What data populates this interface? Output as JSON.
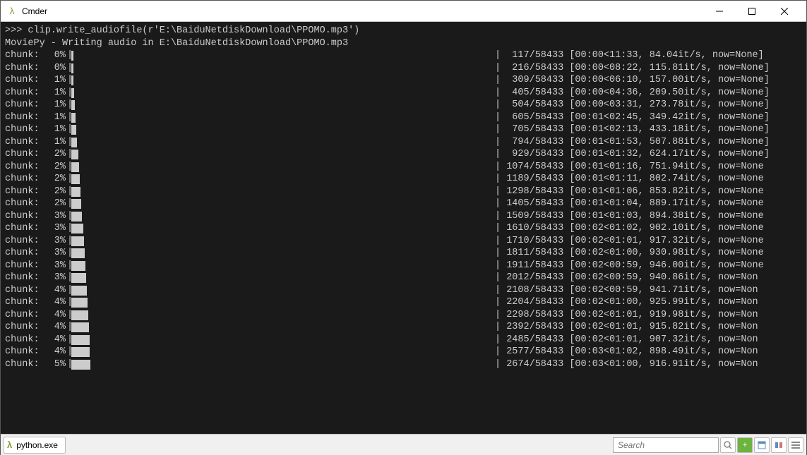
{
  "window": {
    "title": "Cmder"
  },
  "terminal": {
    "prompt": ">>> ",
    "command": "clip.write_audiofile(r'E:\\BaiduNetdiskDownload\\PPOMO.mp3')",
    "status_line": "MoviePy - Writing audio in E:\\BaiduNetdiskDownload\\PPOMO.mp3",
    "label": "chunk:",
    "total": 58433,
    "rows": [
      {
        "pct": "0%",
        "cur": 117,
        "time": "00:00<11:33",
        "rate": "84.04it/s",
        "now": "now=None]"
      },
      {
        "pct": "0%",
        "cur": 216,
        "time": "00:00<08:22",
        "rate": "115.81it/s",
        "now": "now=None]"
      },
      {
        "pct": "1%",
        "cur": 309,
        "time": "00:00<06:10",
        "rate": "157.00it/s",
        "now": "now=None]"
      },
      {
        "pct": "1%",
        "cur": 405,
        "time": "00:00<04:36",
        "rate": "209.50it/s",
        "now": "now=None]"
      },
      {
        "pct": "1%",
        "cur": 504,
        "time": "00:00<03:31",
        "rate": "273.78it/s",
        "now": "now=None]"
      },
      {
        "pct": "1%",
        "cur": 605,
        "time": "00:01<02:45",
        "rate": "349.42it/s",
        "now": "now=None]"
      },
      {
        "pct": "1%",
        "cur": 705,
        "time": "00:01<02:13",
        "rate": "433.18it/s",
        "now": "now=None]"
      },
      {
        "pct": "1%",
        "cur": 794,
        "time": "00:01<01:53",
        "rate": "507.88it/s",
        "now": "now=None]"
      },
      {
        "pct": "2%",
        "cur": 929,
        "time": "00:01<01:32",
        "rate": "624.17it/s",
        "now": "now=None]"
      },
      {
        "pct": "2%",
        "cur": 1074,
        "time": "00:01<01:16",
        "rate": "751.94it/s",
        "now": "now=None"
      },
      {
        "pct": "2%",
        "cur": 1189,
        "time": "00:01<01:11",
        "rate": "802.74it/s",
        "now": "now=None"
      },
      {
        "pct": "2%",
        "cur": 1298,
        "time": "00:01<01:06",
        "rate": "853.82it/s",
        "now": "now=None"
      },
      {
        "pct": "2%",
        "cur": 1405,
        "time": "00:01<01:04",
        "rate": "889.17it/s",
        "now": "now=None"
      },
      {
        "pct": "3%",
        "cur": 1509,
        "time": "00:01<01:03",
        "rate": "894.38it/s",
        "now": "now=None"
      },
      {
        "pct": "3%",
        "cur": 1610,
        "time": "00:02<01:02",
        "rate": "902.10it/s",
        "now": "now=None"
      },
      {
        "pct": "3%",
        "cur": 1710,
        "time": "00:02<01:01",
        "rate": "917.32it/s",
        "now": "now=None"
      },
      {
        "pct": "3%",
        "cur": 1811,
        "time": "00:02<01:00",
        "rate": "930.98it/s",
        "now": "now=None"
      },
      {
        "pct": "3%",
        "cur": 1911,
        "time": "00:02<00:59",
        "rate": "946.00it/s",
        "now": "now=None"
      },
      {
        "pct": "3%",
        "cur": 2012,
        "time": "00:02<00:59",
        "rate": "940.86it/s",
        "now": "now=Non"
      },
      {
        "pct": "4%",
        "cur": 2108,
        "time": "00:02<00:59",
        "rate": "941.71it/s",
        "now": "now=Non"
      },
      {
        "pct": "4%",
        "cur": 2204,
        "time": "00:02<01:00",
        "rate": "925.99it/s",
        "now": "now=Non"
      },
      {
        "pct": "4%",
        "cur": 2298,
        "time": "00:02<01:01",
        "rate": "919.98it/s",
        "now": "now=Non"
      },
      {
        "pct": "4%",
        "cur": 2392,
        "time": "00:02<01:01",
        "rate": "915.82it/s",
        "now": "now=Non"
      },
      {
        "pct": "4%",
        "cur": 2485,
        "time": "00:02<01:01",
        "rate": "907.32it/s",
        "now": "now=Non"
      },
      {
        "pct": "4%",
        "cur": 2577,
        "time": "00:03<01:02",
        "rate": "898.49it/s",
        "now": "now=Non"
      },
      {
        "pct": "5%",
        "cur": 2674,
        "time": "00:03<01:00",
        "rate": "916.91it/s",
        "now": "now=Non"
      }
    ]
  },
  "statusbar": {
    "tab_label": "python.exe",
    "search_placeholder": "Search"
  }
}
